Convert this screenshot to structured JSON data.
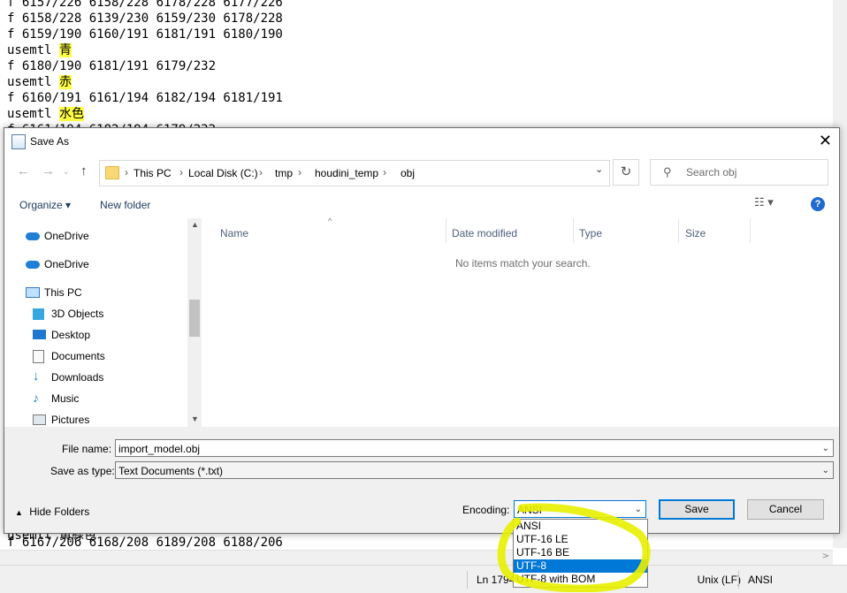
{
  "editor": {
    "lines": [
      {
        "text": "f 6157/226 6158/228 6178/228 6177/226",
        "hl": ""
      },
      {
        "text": "f 6158/228 6139/230 6159/230 6178/228",
        "hl": ""
      },
      {
        "text": "f 6159/190 6160/191 6181/191 6180/190",
        "hl": ""
      },
      {
        "text": "usemtl ",
        "hl": "青"
      },
      {
        "text": "f 6180/190 6181/191 6179/232",
        "hl": ""
      },
      {
        "text": "usemtl ",
        "hl": "赤"
      },
      {
        "text": "f 6160/191 6161/194 6182/194 6181/191",
        "hl": ""
      },
      {
        "text": "usemtl ",
        "hl": "水色"
      },
      {
        "text": "f 6161/194 6182/194 6179/232",
        "hl": ""
      }
    ],
    "bottom_line": "f 6167/206 6168/208 6189/208 6188/206",
    "bottom_partial": "usemtl 黄緑色"
  },
  "status_bar": {
    "position": "Ln 17943",
    "line_ending": "Unix (LF)",
    "encoding": "ANSI"
  },
  "dialog": {
    "title": "Save As",
    "breadcrumbs": [
      "This PC",
      "Local Disk (C:)",
      "tmp",
      "houdini_temp",
      "obj"
    ],
    "search_placeholder": "Search obj",
    "toolbar": {
      "organize": "Organize ▾",
      "new_folder": "New folder"
    },
    "nav_items": [
      {
        "label": "OneDrive",
        "icon": "onedrive-icon"
      },
      {
        "label": "OneDrive",
        "icon": "onedrive-icon"
      },
      {
        "label": "This PC",
        "icon": "pc-icon"
      },
      {
        "label": "3D Objects",
        "icon": "cube-icon"
      },
      {
        "label": "Desktop",
        "icon": "desktop-icon"
      },
      {
        "label": "Documents",
        "icon": "document-icon"
      },
      {
        "label": "Downloads",
        "icon": "download-icon"
      },
      {
        "label": "Music",
        "icon": "music-icon"
      },
      {
        "label": "Pictures",
        "icon": "pictures-icon"
      }
    ],
    "columns": [
      "Name",
      "Date modified",
      "Type",
      "Size"
    ],
    "empty_message": "No items match your search.",
    "file_name_label": "File name:",
    "file_name_value": "import_model.obj",
    "save_type_label": "Save as type:",
    "save_type_value": "Text Documents (*.txt)",
    "hide_folders": "Hide Folders",
    "encoding_label": "Encoding:",
    "encoding_value": "ANSI",
    "save_button": "Save",
    "cancel_button": "Cancel",
    "encoding_options": [
      "ANSI",
      "UTF-16 LE",
      "UTF-16 BE",
      "UTF-8",
      "UTF-8 with BOM"
    ],
    "encoding_selected": "UTF-8"
  },
  "colors": {
    "selection": "#0078d7",
    "highlight": "#ffff44",
    "annotation": "#e8f000"
  }
}
